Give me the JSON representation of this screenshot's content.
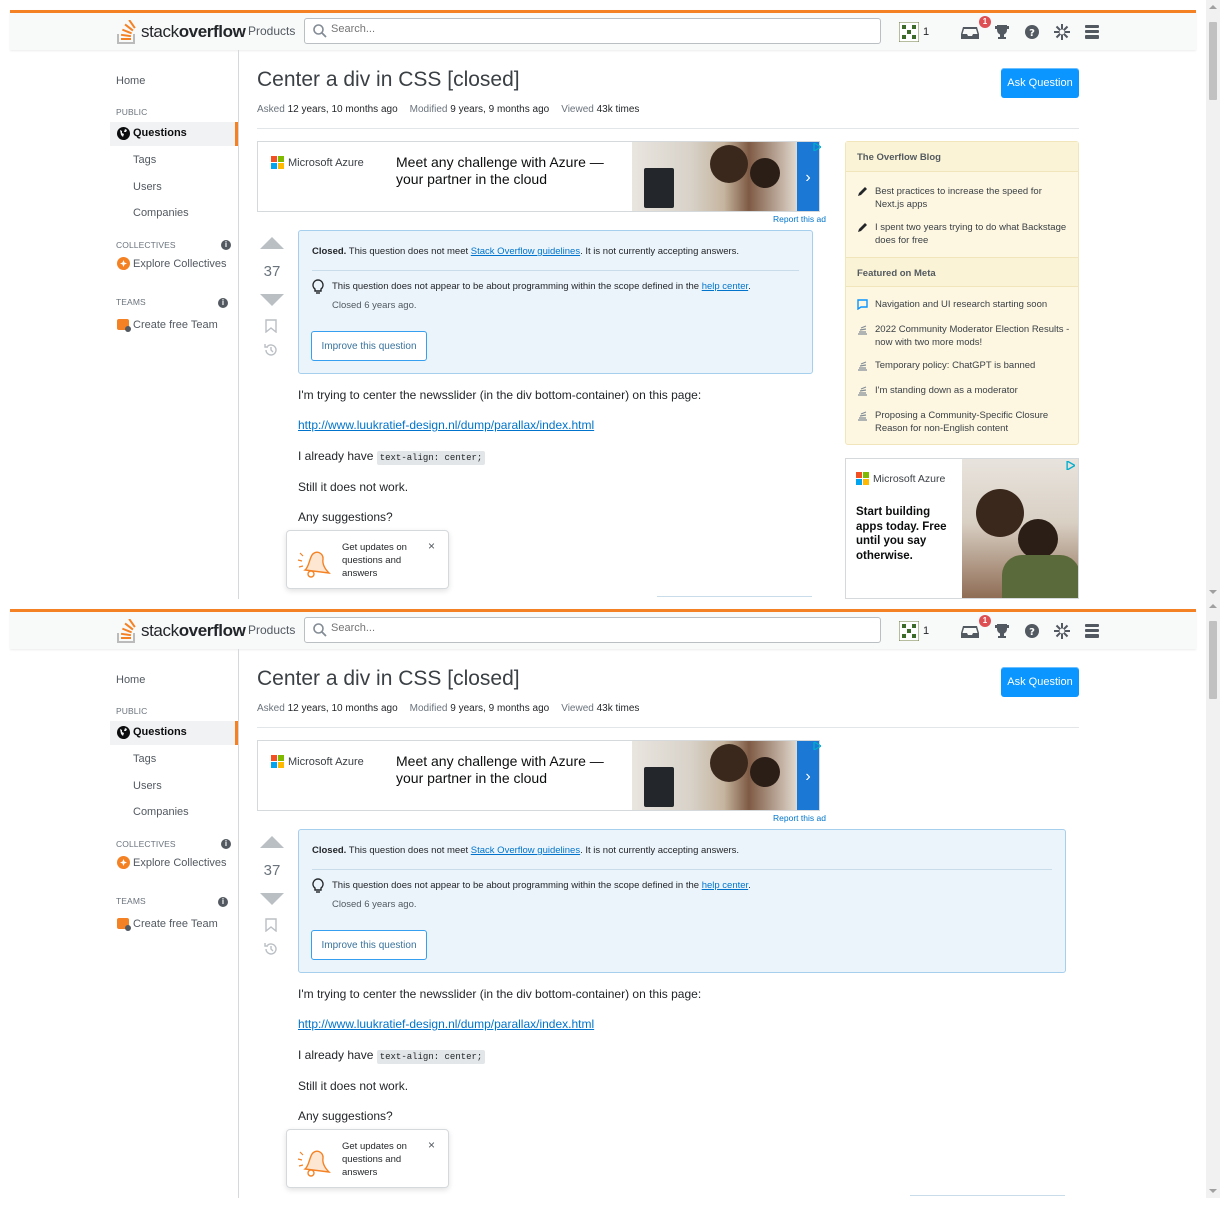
{
  "topbar": {
    "logo_light": "stack",
    "logo_bold": "overflow",
    "products": "Products",
    "search_placeholder": "Search...",
    "reputation": "1",
    "inbox_badge": "1"
  },
  "leftnav": {
    "home": "Home",
    "public_header": "PUBLIC",
    "questions": "Questions",
    "tags": "Tags",
    "users": "Users",
    "companies": "Companies",
    "collectives_header": "COLLECTIVES",
    "explore_collectives": "Explore Collectives",
    "teams_header": "TEAMS",
    "create_team": "Create free Team"
  },
  "question": {
    "title": "Center a div in CSS [closed]",
    "ask_button": "Ask Question",
    "asked_label": "Asked",
    "asked_value": "12 years, 10 months ago",
    "modified_label": "Modified",
    "modified_value": "9 years, 9 months ago",
    "viewed_label": "Viewed",
    "viewed_value": "43k times",
    "votes": "37"
  },
  "ad": {
    "brand": "Microsoft Azure",
    "headline_1": "Meet any challenge with Azure —",
    "headline_2": "your partner in the cloud",
    "arrow": "›",
    "report": "Report this ad",
    "brand_colors": [
      "#f25022",
      "#7fba00",
      "#00a4ef",
      "#ffb900"
    ]
  },
  "notice": {
    "closed": "Closed.",
    "text_pre": " This question does not meet ",
    "guidelines_link": "Stack Overflow guidelines",
    "text_post": ". It is not currently accepting answers.",
    "reason_pre": "This question does not appear to be about programming within the scope defined in the ",
    "help_link": "help center",
    "reason_post": ".",
    "closed_ago": "Closed 6 years ago.",
    "improve_button": "Improve this question"
  },
  "body": {
    "p1": "I'm trying to center the newsslider (in the div bottom-container) on this page:",
    "link": "http://www.luukratief-design.nl/dump/parallax/index.html",
    "p3_text": "I already have ",
    "p3_code": "text-align: center;",
    "p4": "Still it does not work.",
    "p5": "Any suggestions?"
  },
  "toast": {
    "message": "Get updates on questions and answers",
    "close": "×"
  },
  "sidebar": {
    "blog_header": "The Overflow Blog",
    "blog_items": [
      "Best practices to increase the speed for Next.js apps",
      "I spent two years trying to do what Backstage does for free"
    ],
    "meta_header": "Featured on Meta",
    "meta_items": [
      "Navigation and UI research starting soon",
      "2022 Community Moderator Election Results - now with two more mods!",
      "Temporary policy: ChatGPT is banned",
      "I'm standing down as a moderator",
      "Proposing a Community-Specific Closure Reason for non-English content"
    ]
  },
  "ad2": {
    "brand": "Microsoft Azure",
    "text": "Start building apps today. Free until you say otherwise."
  },
  "colors": {
    "accent_orange": "#f48225",
    "primary_blue": "#0a95ff",
    "notice_bg": "#ebf4fb",
    "sidebar_bg": "#fdf7e2"
  }
}
